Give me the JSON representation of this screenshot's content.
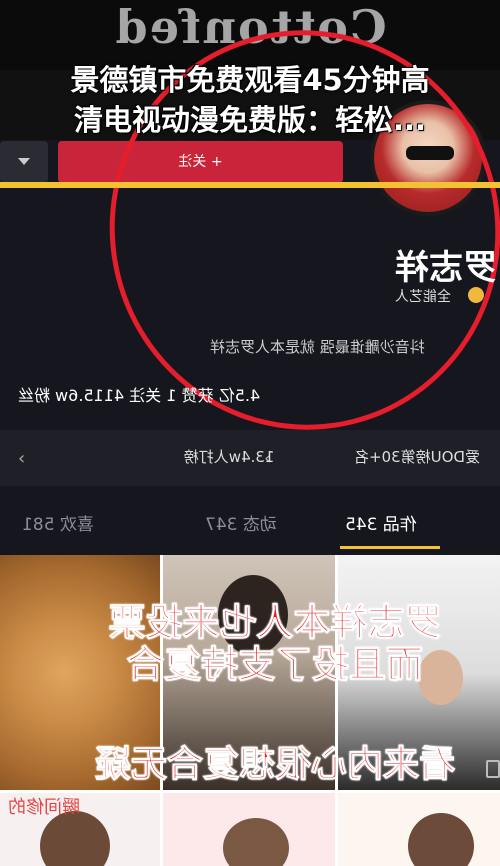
{
  "headline": {
    "line1": "景德镇市免费观看45分钟高",
    "line2": "清电视动漫免费版：轻松..."
  },
  "logo": {
    "text": "Cottonfed"
  },
  "profile": {
    "follow_label": "+ 关注",
    "name": "罗志祥",
    "badge": "全能艺人",
    "bio": "抖音沙雕谁最强 就是本人罗志祥",
    "stats": "4.5亿 获赞   1 关注   4115.6w 粉丝"
  },
  "rank": {
    "left": "13.4w人打榜",
    "right": "爱DOU榜第30+名"
  },
  "tabs": [
    {
      "label": "作品 345"
    },
    {
      "label": "动态 347"
    },
    {
      "label": "喜欢 581"
    }
  ],
  "captions": {
    "line1": "罗志祥本人也来投票",
    "line2": "而且投了支持复合",
    "line3": "看来内心很想复合无疑"
  },
  "watermark": "瞬间修的",
  "colors": {
    "accent_red": "#e51d2c",
    "accent_yellow": "#f2c230"
  }
}
